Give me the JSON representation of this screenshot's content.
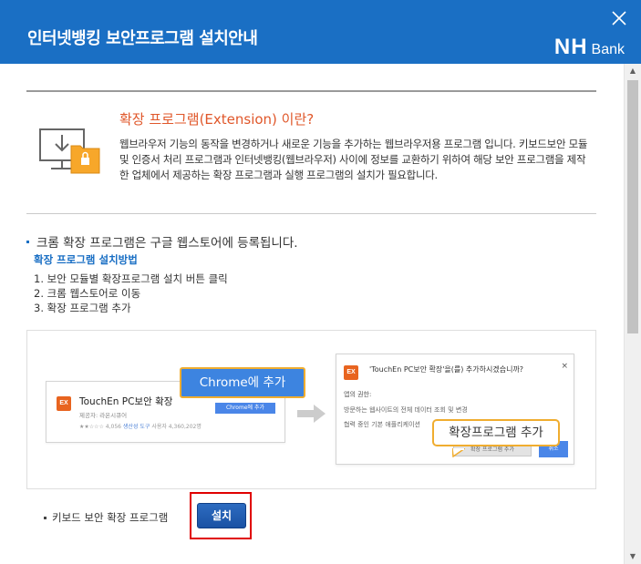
{
  "header": {
    "title": "인터넷뱅킹 보안프로그램 설치안내",
    "logo_nh": "NH",
    "logo_bank": "Bank",
    "close_icon": "close-icon",
    "bg_color": "#1a6fc4"
  },
  "extension": {
    "title": "확장 프로그램(Extension) 이란?",
    "description": "웹브라우저 기능의 동작을 변경하거나 새로운 기능을 추가하는 웹브라우저용 프로그램 입니다. 키보드보안 모듈 및 인증서 처리 프로그램과 인터넷뱅킹(웹브라우저) 사이에 정보를 교환하기 위하여 해당 보안 프로그램을 제작한 업체에서 제공하는 확장 프로그램과 실행 프로그램의 설치가 필요합니다.",
    "icon": "monitor-lock-folder-icon",
    "title_color": "#e0572a"
  },
  "notice": {
    "text": "크롬 확장 프로그램은 구글 웹스토어에 등록됩니다.",
    "method_title": "확장 프로그램 설치방법",
    "steps": [
      "1. 보안 모듈별 확장프로그램 설치 버튼 클릭",
      "2. 크롬 웹스토어로 이동",
      "3. 확장 프로그램 추가"
    ]
  },
  "illustration": {
    "store_card": {
      "badge": "EX",
      "app_name": "TouchEn PC보안 확장",
      "app_sub": "제공자: 라온시큐어",
      "app_meta_rating": "★★☆☆☆ 4,056",
      "app_meta_category": "생산성 도구",
      "app_meta_users": "사용자 4,360,202명",
      "add_chip": "Chrome에 추가"
    },
    "chrome_button": "Chrome에 추가",
    "dialog": {
      "badge": "EX",
      "question": "'TouchEn PC보안 확장'을(를) 추가하시겠습니까?",
      "close": "×",
      "perm_title": "앱의 권한:",
      "perm_1": "방문하는 웹사이트의 전체 데이터 조회 및 변경",
      "perm_2": "협력 중인 기본 애플리케이션",
      "add_button": "확장 프로그램 추가",
      "cancel_button": "취소"
    },
    "ext_add_bubble": "확장프로그램 추가",
    "accent_orange": "#f0ad2f",
    "accent_blue": "#3d84e0"
  },
  "install": {
    "label": "키보드 보안 확장 프로그램",
    "button": "설치",
    "frame_color": "#e00000"
  },
  "scrollbar": {
    "up": "▲",
    "down": "▼"
  }
}
